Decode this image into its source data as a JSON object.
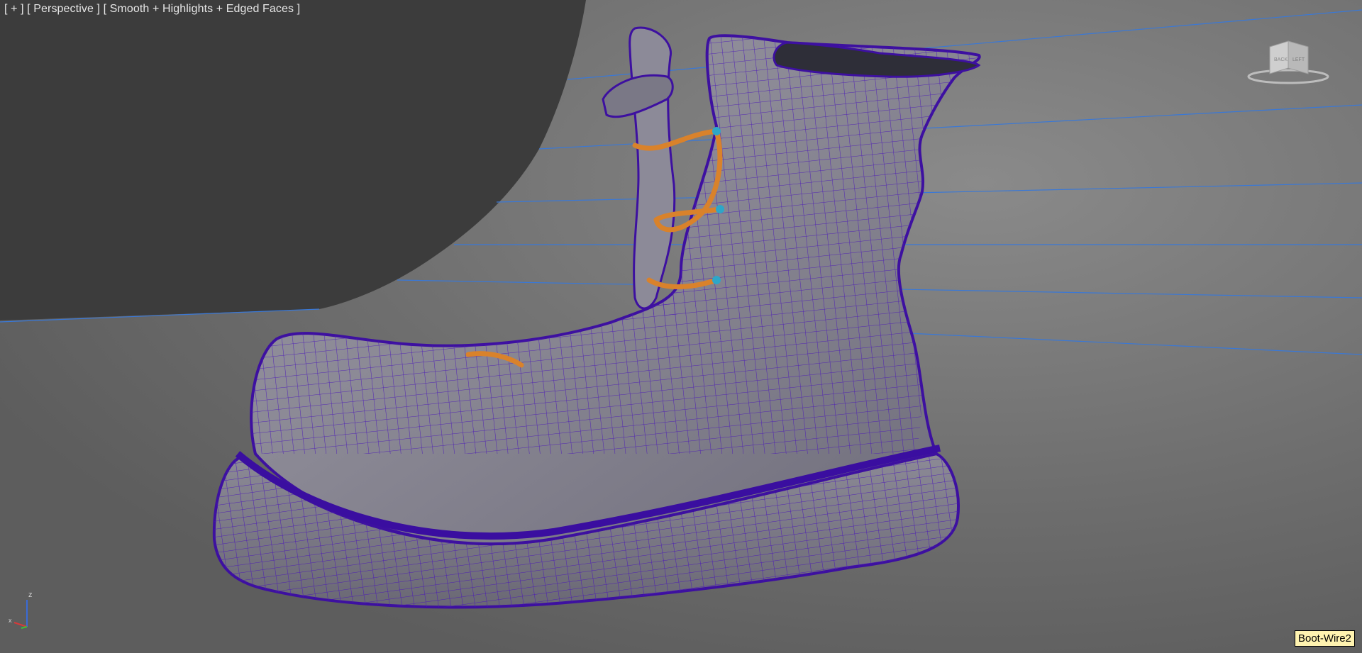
{
  "viewport": {
    "label": {
      "plus_menu": "[ + ]",
      "view_menu": "[ Perspective ]",
      "shading_menu": "[ Smooth + Highlights + Edged Faces ]"
    },
    "viewcube": {
      "faces": [
        "BACK",
        "LEFT"
      ]
    },
    "axis": {
      "z": "z",
      "x": "x"
    },
    "object_tag": "Boot-Wire2"
  },
  "colors": {
    "background": "#6f6f6f",
    "dark_panel": "#3d3d3d",
    "wire": "#4a17b8",
    "mesh_fill": "#8e8e98",
    "lace": "#d9822b",
    "grid_line": "#3a78d6",
    "tag_bg": "#fff3b0"
  },
  "icons": {
    "viewcube": "viewcube-icon",
    "axis": "axis-tripod-icon"
  }
}
